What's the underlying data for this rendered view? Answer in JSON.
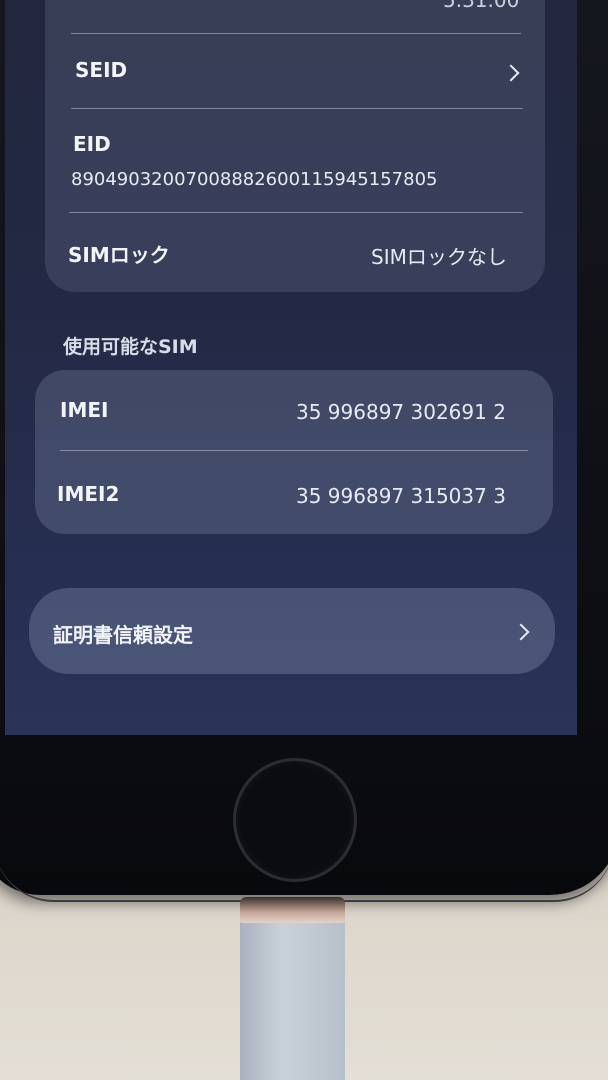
{
  "card1": {
    "partial_value": "5.31.00",
    "seid_label": "SEID",
    "eid_label": "EID",
    "eid_value": "89049032007008882600115945157805",
    "simlock_label": "SIMロック",
    "simlock_value": "SIMロックなし"
  },
  "section_header": "使用可能なSIM",
  "sims": {
    "imei_label": "IMEI",
    "imei_value": "35 996897 302691 2",
    "imei2_label": "IMEI2",
    "imei2_value": "35 996897 315037 3"
  },
  "cert": {
    "label": "証明書信頼設定"
  },
  "icons": [
    "chevron-right-icon",
    "home-button"
  ]
}
